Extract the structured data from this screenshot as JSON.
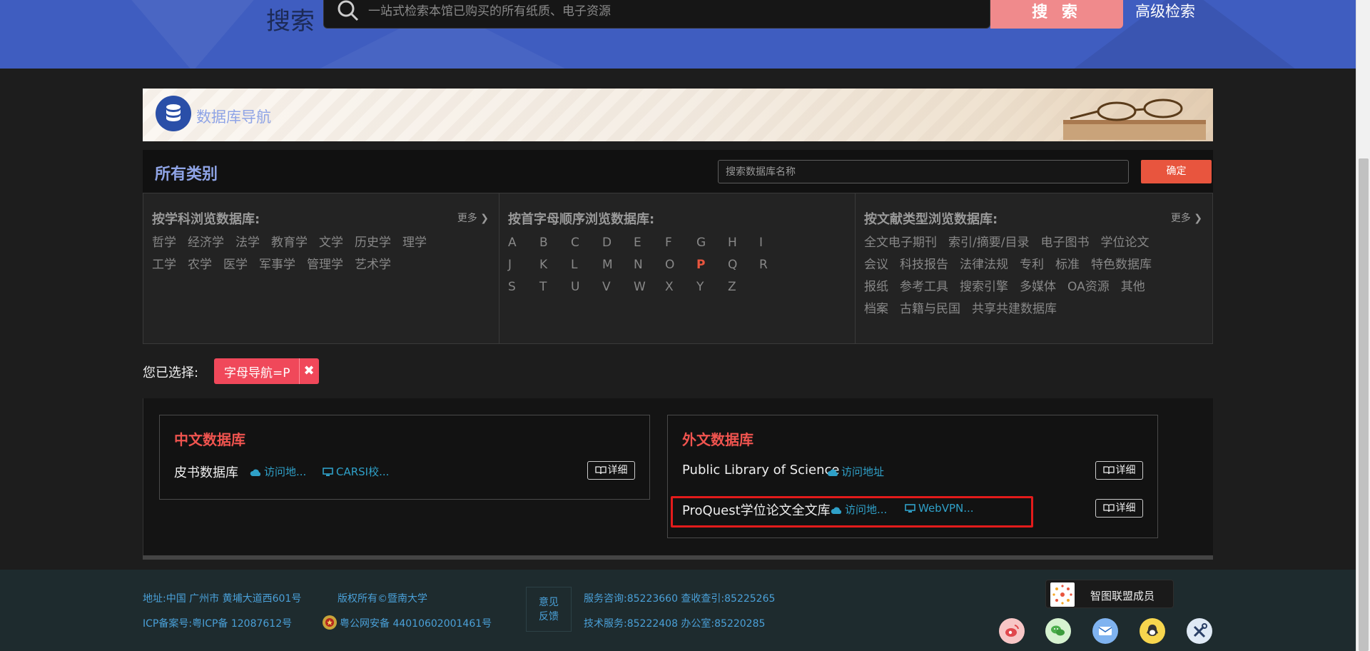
{
  "header": {
    "search_label": "搜索",
    "search_placeholder": "一站式检索本馆已购买的所有纸质、电子资源",
    "search_button": "搜 索",
    "advanced_search": "高级检索"
  },
  "db_banner": {
    "title": "数据库导航"
  },
  "category_bar": {
    "title": "所有类别",
    "search_placeholder": "搜索数据库名称",
    "confirm": "确定"
  },
  "browse": {
    "subject": {
      "title": "按学科浏览数据库:",
      "more": "更多",
      "items": [
        "哲学",
        "经济学",
        "法学",
        "教育学",
        "文学",
        "历史学",
        "理学",
        "工学",
        "农学",
        "医学",
        "军事学",
        "管理学",
        "艺术学"
      ]
    },
    "alphabet": {
      "title": "按首字母顺序浏览数据库:",
      "letters": [
        "A",
        "B",
        "C",
        "D",
        "E",
        "F",
        "G",
        "H",
        "I",
        "J",
        "K",
        "L",
        "M",
        "N",
        "O",
        "P",
        "Q",
        "R",
        "S",
        "T",
        "U",
        "V",
        "W",
        "X",
        "Y",
        "Z"
      ],
      "active": "P"
    },
    "doctype": {
      "title": "按文献类型浏览数据库:",
      "more": "更多",
      "items": [
        "全文电子期刊",
        "索引/摘要/目录",
        "电子图书",
        "学位论文",
        "会议",
        "科技报告",
        "法律法规",
        "专利",
        "标准",
        "特色数据库",
        "报纸",
        "参考工具",
        "搜索引擎",
        "多媒体",
        "OA资源",
        "其他",
        "档案",
        "古籍与民国",
        "共享共建数据库"
      ]
    }
  },
  "selected": {
    "label": "您已选择:",
    "tag": "字母导航=P",
    "remove": "✖"
  },
  "results": {
    "chinese": {
      "title": "中文数据库",
      "rows": [
        {
          "name": "皮书数据库",
          "link1": "访问地...",
          "link2": "CARSI校...",
          "detail": "详细"
        }
      ]
    },
    "foreign": {
      "title": "外文数据库",
      "rows": [
        {
          "name": "Public Library of Science",
          "link1": "访问地址",
          "detail": "详细"
        },
        {
          "name": "ProQuest学位论文全文库",
          "link1": "访问地...",
          "link2": "WebVPN...",
          "detail": "详细"
        }
      ]
    }
  },
  "footer": {
    "address": "地址:中国 广州市 黄埔大道西601号",
    "copyright": "版权所有©暨南大学",
    "icp": "ICP备案号:粤ICP备 12087612号",
    "police": "粤公网安备 44010602001461号",
    "feedback_line1": "意见",
    "feedback_line2": "反馈",
    "service": "服务咨询:85223660 查收查引:85225265",
    "tech": "技术服务:85222408 办公室:85220285",
    "alliance": "智图联盟成员"
  },
  "social_icons": [
    "weibo-icon",
    "wechat-icon",
    "mail-icon",
    "qq-icon",
    "tools-icon"
  ]
}
